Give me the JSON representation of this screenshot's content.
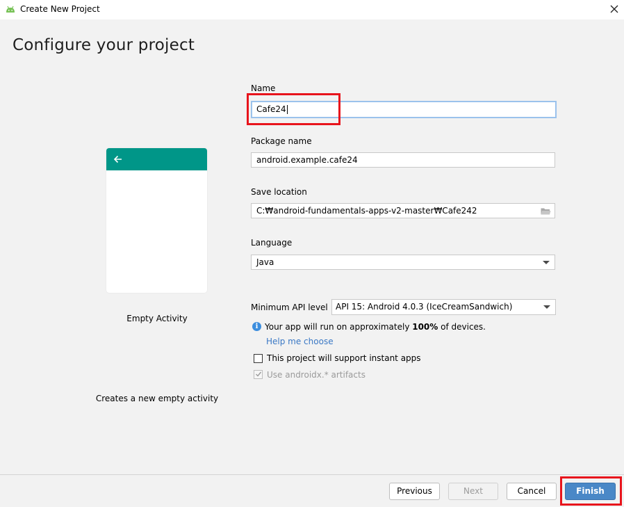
{
  "window": {
    "title": "Create New Project",
    "app_icon": "android-icon",
    "close_icon": "close-icon"
  },
  "page": {
    "title": "Configure your project"
  },
  "template": {
    "name": "Empty Activity",
    "description": "Creates a new empty activity",
    "appbar_color": "#009688",
    "back_icon": "arrow-left-icon"
  },
  "form": {
    "name": {
      "label": "Name",
      "value": "Cafe24"
    },
    "package_name": {
      "label": "Package name",
      "value": "android.example.cafe24"
    },
    "save_location": {
      "label": "Save location",
      "value": "C:₩android-fundamentals-apps-v2-master₩Cafe242",
      "icon": "folder-icon"
    },
    "language": {
      "label": "Language",
      "value": "Java"
    },
    "minimum_api": {
      "label": "Minimum API level",
      "value": "API 15: Android 4.0.3 (IceCreamSandwich)"
    },
    "info": {
      "icon": "info-icon",
      "prefix": "Your app will run on approximately ",
      "percent": "100%",
      "suffix": " of devices.",
      "help_link": "Help me choose"
    },
    "instant_apps": {
      "label": "This project will support instant apps",
      "checked": false
    },
    "androidx": {
      "label": "Use androidx.* artifacts",
      "checked": true,
      "disabled": true
    }
  },
  "buttons": {
    "previous": "Previous",
    "next": "Next",
    "cancel": "Cancel",
    "finish": "Finish"
  },
  "colors": {
    "accent": "#4a88c7",
    "highlight": "#e8141c",
    "link": "#3a78c5"
  }
}
